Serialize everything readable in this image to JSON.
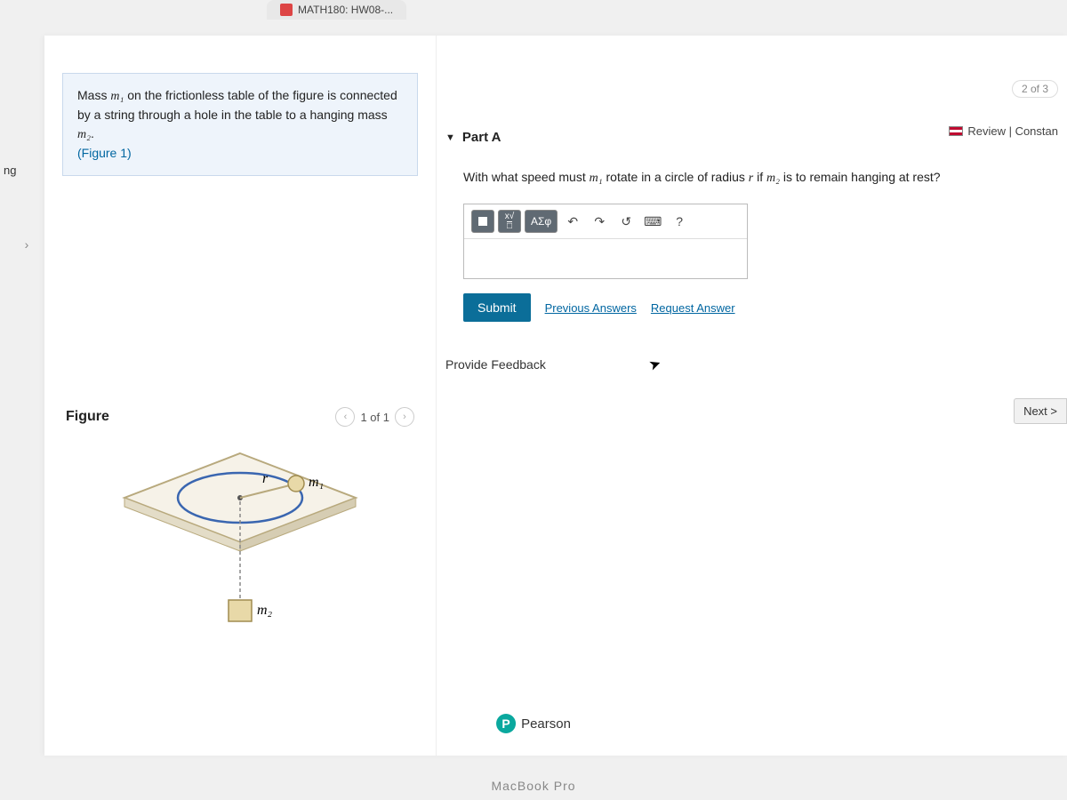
{
  "browser": {
    "tab_title": "MATH180: HW08-..."
  },
  "left_edge_text": "ng",
  "header": {
    "progress": "2 of 3",
    "review_link": "Review | Constan"
  },
  "problem": {
    "desc_prefix": "Mass ",
    "m1": "m₁",
    "desc_mid1": " on the frictionless table of the figure is connected by a string through a hole in the table to a hanging mass ",
    "m2": "m₂",
    "desc_end": ".",
    "figure_link": "(Figure 1)"
  },
  "figure": {
    "title": "Figure",
    "counter": "1 of 1",
    "label_r": "r",
    "label_m1": "m₁",
    "label_m2": "m₂"
  },
  "part": {
    "label": "Part A",
    "q_prefix": "With what speed must ",
    "q_m1": "m₁",
    "q_mid": " rotate in a circle of radius ",
    "q_r": "r",
    "q_mid2": " if ",
    "q_m2": "m₂",
    "q_end": " is to remain hanging at rest?"
  },
  "toolbar": {
    "greek": "ΑΣφ",
    "help": "?"
  },
  "actions": {
    "submit": "Submit",
    "prev_answers": "Previous Answers",
    "request_answer": "Request Answer",
    "provide_feedback": "Provide Feedback",
    "next": "Next >"
  },
  "footer": {
    "brand": "Pearson",
    "device": "MacBook Pro"
  }
}
